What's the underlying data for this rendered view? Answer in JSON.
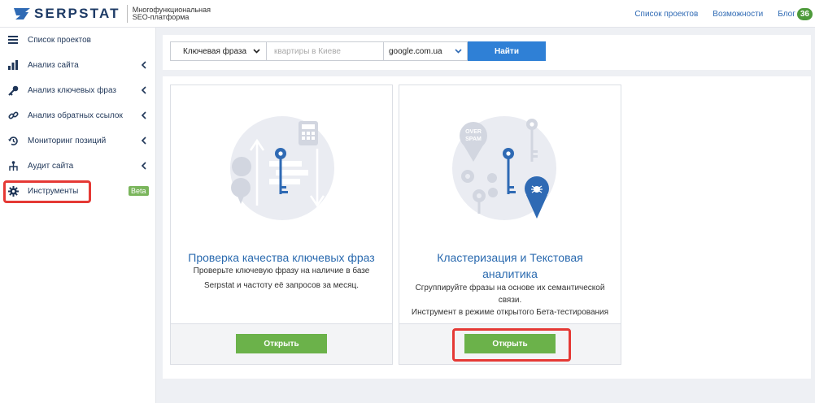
{
  "header": {
    "logo_text": "SERPSTAT",
    "tagline_line1": "Многофункциональная",
    "tagline_line2": "SEO-платформа",
    "nav": {
      "projects": "Список проектов",
      "features": "Возможности",
      "blog": "Блог",
      "blog_count": "36"
    }
  },
  "sidebar": {
    "items": [
      {
        "label": "Список проектов",
        "icon": "list-icon"
      },
      {
        "label": "Анализ сайта",
        "icon": "bar-chart-icon"
      },
      {
        "label": "Анализ ключевых фраз",
        "icon": "key-icon"
      },
      {
        "label": "Анализ обратных ссылок",
        "icon": "link-icon"
      },
      {
        "label": "Мониторинг позиций",
        "icon": "history-icon"
      },
      {
        "label": "Аудит сайта",
        "icon": "sitemap-icon"
      },
      {
        "label": "Инструменты",
        "icon": "gear-icon",
        "badge": "Beta"
      }
    ]
  },
  "search": {
    "type_value": "Ключевая фраза",
    "query_placeholder": "квартиры в Киеве",
    "engine_value": "google.com.ua",
    "submit_label": "Найти"
  },
  "cards": [
    {
      "title": "Проверка качества ключевых фраз",
      "desc_line1": "Проверьте ключевую фразу на наличие в базе",
      "desc_line2": "Serpstat и частоту её запросов за месяц.",
      "button": "Открыть"
    },
    {
      "title_line1": "Кластеризация и Текстовая",
      "title_line2": "аналитика",
      "desc_line1": "Сгруппируйте фразы на основе их семантической",
      "desc_line2": "связи.",
      "desc_line3": "Инструмент в режиме открытого Бета-тестирования",
      "button": "Открыть",
      "bubble_text_line1": "OVER",
      "bubble_text_line2": "SPAM"
    }
  ],
  "colors": {
    "accent_blue": "#2f80d6",
    "open_green": "#6bb24a",
    "highlight_red": "#e53935",
    "brand_navy": "#1e3b66"
  }
}
